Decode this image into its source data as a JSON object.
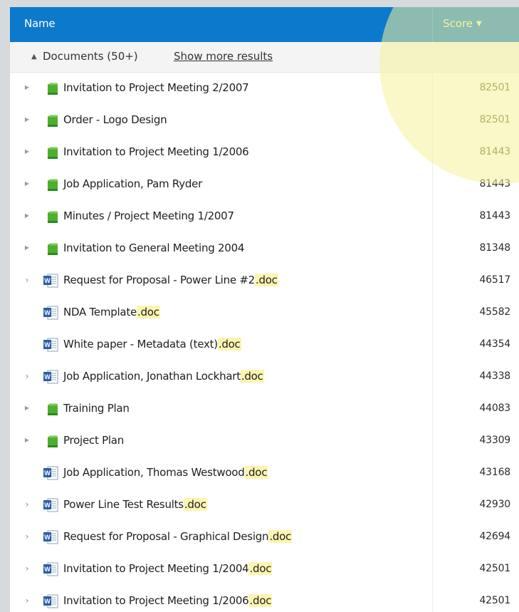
{
  "header": {
    "name_label": "Name",
    "score_label": "Score",
    "sort_icon": "sort-descending-triangle"
  },
  "group": {
    "title": "Documents (50+)",
    "show_more": "Show more results",
    "collapse_icon": "triangle-up"
  },
  "colors": {
    "header_bg": "#0c79cc",
    "folder_green": "#4caf2f",
    "doc_blue": "#2b5fa5",
    "extension_highlight": "#fbf5b0",
    "spotlight": "#f6f39a"
  },
  "rows": [
    {
      "name": "Invitation to Project Meeting 2/2007",
      "ext": "",
      "score": "82501",
      "type": "folder"
    },
    {
      "name": "Order - Logo Design",
      "ext": "",
      "score": "82501",
      "type": "folder"
    },
    {
      "name": "Invitation to Project Meeting 1/2006",
      "ext": "",
      "score": "81443",
      "type": "folder"
    },
    {
      "name": "Job Application, Pam Ryder",
      "ext": "",
      "score": "81443",
      "type": "folder"
    },
    {
      "name": "Minutes / Project Meeting 1/2007",
      "ext": "",
      "score": "81443",
      "type": "folder"
    },
    {
      "name": "Invitation to General Meeting 2004",
      "ext": "",
      "score": "81348",
      "type": "folder"
    },
    {
      "name": "Request for Proposal - Power Line #2",
      "ext": ".doc",
      "score": "46517",
      "type": "doc"
    },
    {
      "name": "NDA Template",
      "ext": ".doc",
      "score": "45582",
      "type": "doc"
    },
    {
      "name": "White paper - Metadata (text)",
      "ext": ".doc",
      "score": "44354",
      "type": "doc"
    },
    {
      "name": "Job Application, Jonathan Lockhart",
      "ext": ".doc",
      "score": "44338",
      "type": "doc"
    },
    {
      "name": "Training Plan",
      "ext": "",
      "score": "44083",
      "type": "folder"
    },
    {
      "name": "Project Plan",
      "ext": "",
      "score": "43309",
      "type": "folder"
    },
    {
      "name": "Job Application, Thomas Westwood",
      "ext": ".doc",
      "score": "43168",
      "type": "doc"
    },
    {
      "name": "Power Line Test Results",
      "ext": ".doc",
      "score": "42930",
      "type": "doc"
    },
    {
      "name": "Request for Proposal - Graphical Design",
      "ext": ".doc",
      "score": "42694",
      "type": "doc"
    },
    {
      "name": "Invitation to Project Meeting 1/2004",
      "ext": ".doc",
      "score": "42501",
      "type": "doc"
    },
    {
      "name": "Invitation to Project Meeting 1/2006",
      "ext": ".doc",
      "score": "42501",
      "type": "doc"
    }
  ]
}
